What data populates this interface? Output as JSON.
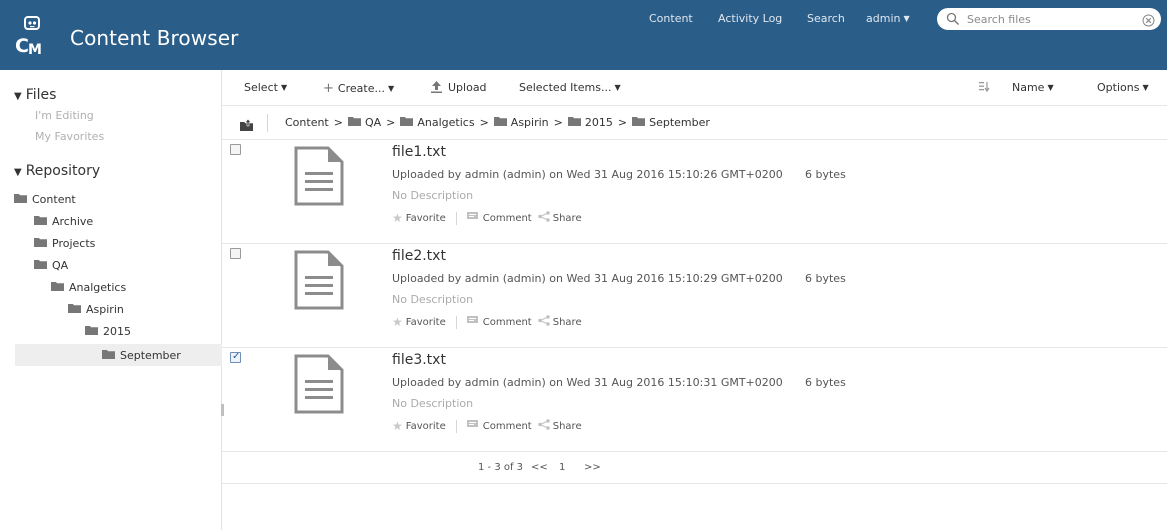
{
  "app": {
    "title": "Content Browser"
  },
  "topnav": {
    "content": "Content",
    "activity_log": "Activity Log",
    "search": "Search",
    "user": "admin"
  },
  "search": {
    "placeholder": "Search files",
    "value": ""
  },
  "sidebar": {
    "files_title": "Files",
    "files_links": [
      "I'm Editing",
      "My Favorites"
    ],
    "repository_title": "Repository",
    "tree": [
      {
        "label": "Content",
        "level": 0
      },
      {
        "label": "Archive",
        "level": 1
      },
      {
        "label": "Projects",
        "level": 1
      },
      {
        "label": "QA",
        "level": 1
      },
      {
        "label": "Analgetics",
        "level": 2
      },
      {
        "label": "Aspirin",
        "level": 3
      },
      {
        "label": "2015",
        "level": 4
      },
      {
        "label": "September",
        "level": 5,
        "selected": true
      }
    ]
  },
  "toolbar": {
    "select": "Select",
    "create": "Create...",
    "upload": "Upload",
    "selected_items": "Selected Items...",
    "sort": "Name",
    "options": "Options"
  },
  "breadcrumb": {
    "items": [
      "Content",
      "QA",
      "Analgetics",
      "Aspirin",
      "2015",
      "September"
    ]
  },
  "files": [
    {
      "name": "file1.txt",
      "meta": "Uploaded by admin (admin) on Wed 31 Aug 2016 15:10:26 GMT+0200",
      "size": "6 bytes",
      "description": "No Description",
      "checked": false
    },
    {
      "name": "file2.txt",
      "meta": "Uploaded by admin (admin) on Wed 31 Aug 2016 15:10:29 GMT+0200",
      "size": "6 bytes",
      "description": "No Description",
      "checked": false
    },
    {
      "name": "file3.txt",
      "meta": "Uploaded by admin (admin) on Wed 31 Aug 2016 15:10:31 GMT+0200",
      "size": "6 bytes",
      "description": "No Description",
      "checked": true
    }
  ],
  "actions": {
    "favorite": "Favorite",
    "comment": "Comment",
    "share": "Share"
  },
  "pager": {
    "summary": "1 - 3 of 3",
    "prev": "<<",
    "page": "1",
    "next": ">>"
  },
  "colors": {
    "header": "#2a5d88",
    "selected_row": "#eeeeee"
  }
}
